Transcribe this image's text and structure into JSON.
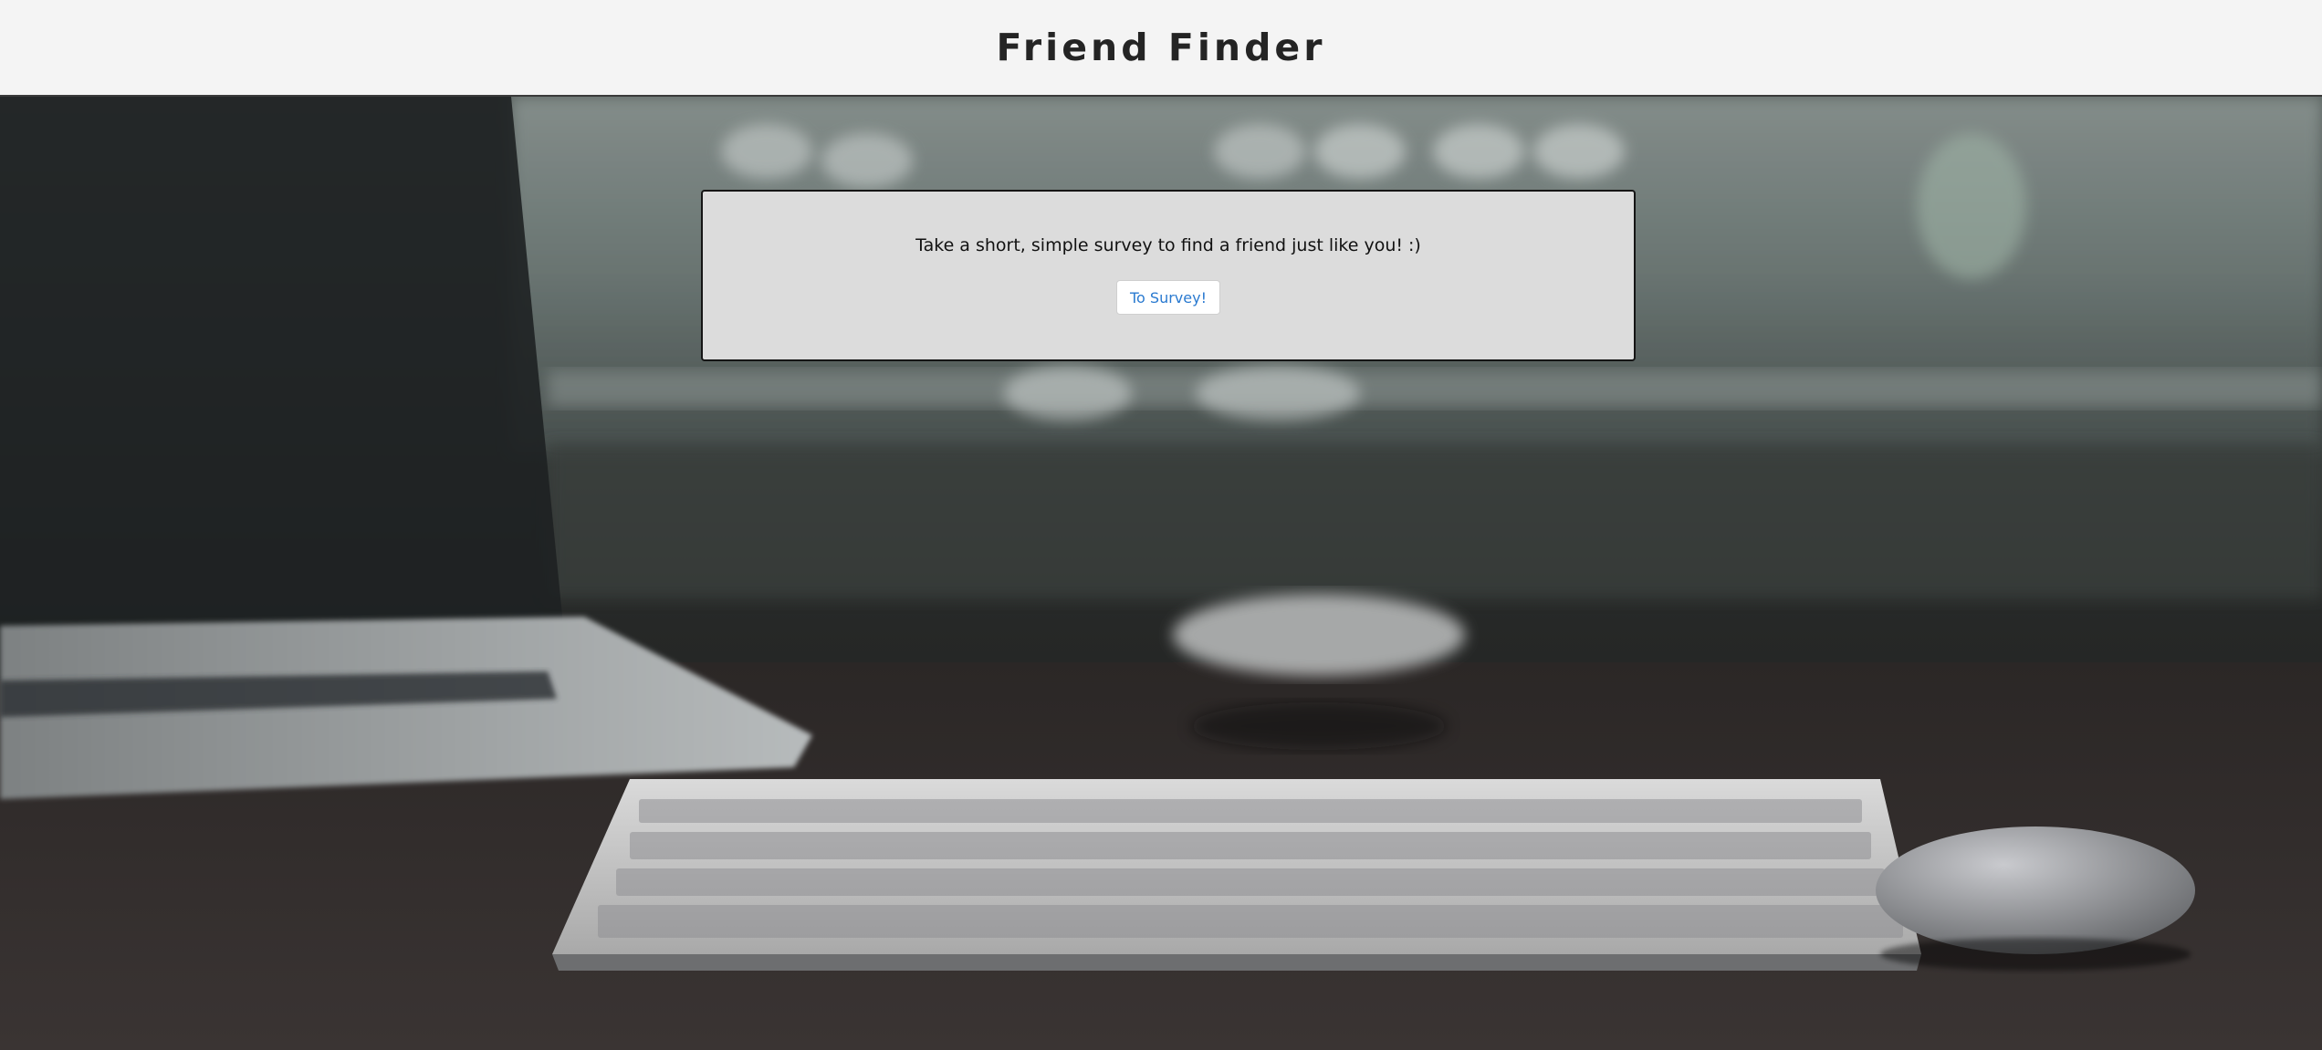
{
  "header": {
    "title": "Friend Finder"
  },
  "panel": {
    "message": "Take a short, simple survey to find a friend just like you! :)",
    "button_label": "To Survey!"
  },
  "colors": {
    "header_bg": "#f4f4f4",
    "panel_bg": "#dcdcdc",
    "button_text": "#2a7ad0"
  }
}
